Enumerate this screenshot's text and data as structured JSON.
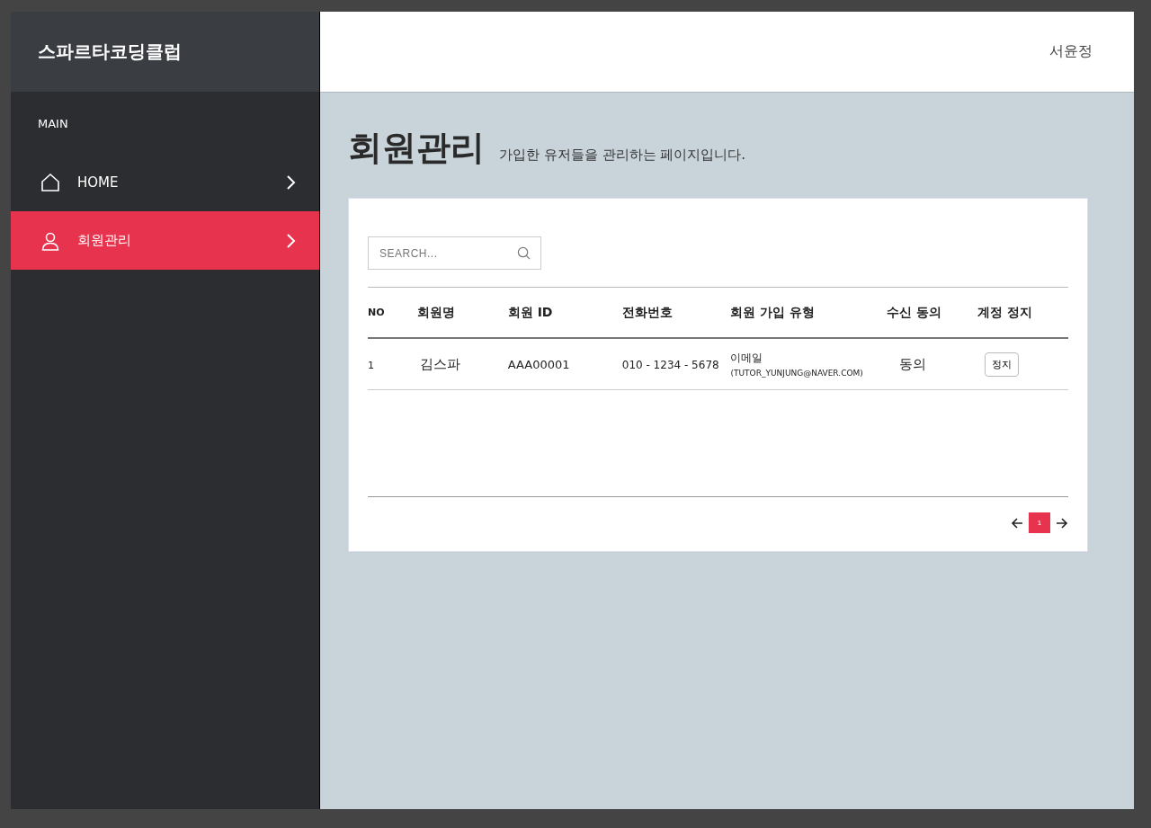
{
  "brand": "스파르타코딩클럽",
  "sidebar": {
    "section": "MAIN",
    "items": [
      {
        "label": "HOME",
        "selected": false
      },
      {
        "label": "회원관리",
        "selected": true
      }
    ]
  },
  "topbar": {
    "user": "서윤정"
  },
  "page": {
    "title": "회원관리",
    "subtitle": "가입한 유저들을 관리하는 페이지입니다."
  },
  "search": {
    "placeholder": "SEARCH..."
  },
  "table": {
    "columns": [
      "NO",
      "회원명",
      "회원 ID",
      "전화번호",
      "회원 가입 유형",
      "수신 동의",
      "계정 정지"
    ],
    "rows": [
      {
        "no": "1",
        "name": "김스파",
        "id": "AAA00001",
        "phone": "010 - 1234 - 5678",
        "signup_type": "이메일",
        "email": "(TUTOR_YUNJUNG@NAVER.COM)",
        "consent": "동의",
        "action": "정지"
      }
    ]
  },
  "pagination": {
    "pages": [
      {
        "label": "1",
        "selected": true
      }
    ]
  }
}
